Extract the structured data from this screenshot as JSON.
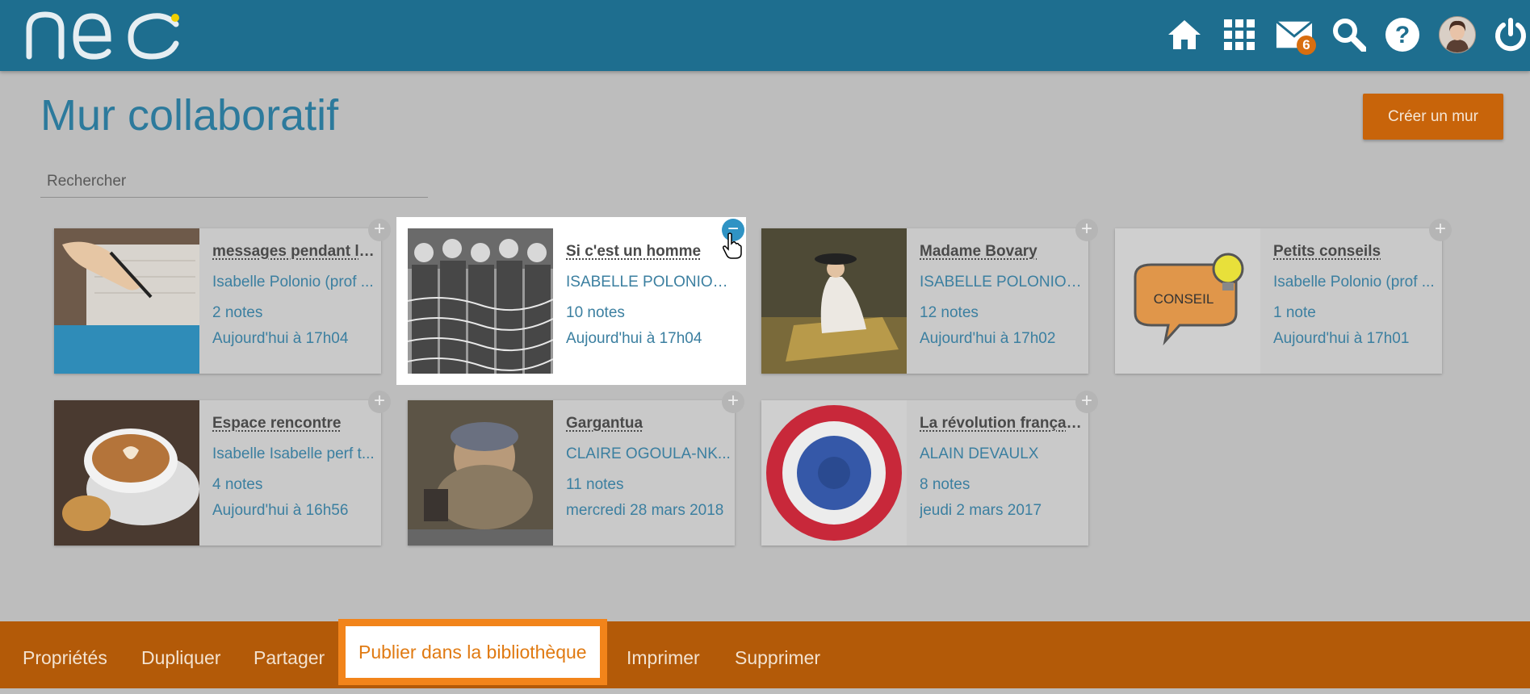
{
  "brand": {
    "logo_text": "neo",
    "logo_dot_color": "#f0d000"
  },
  "nav": {
    "icons": [
      "home-icon",
      "apps-grid-icon",
      "mail-icon",
      "search-icon",
      "help-icon",
      "avatar",
      "power-icon"
    ],
    "mail_badge": "6"
  },
  "page": {
    "title": "Mur collaboratif",
    "create_button": "Créer un mur",
    "search_placeholder": "Rechercher"
  },
  "cards": [
    {
      "title": "messages pendant le...",
      "owner": "Isabelle Polonio (prof ...",
      "notes": "2 notes",
      "date": "Aujourd'hui à 17h04",
      "selected": false,
      "thumb": "writing-hand"
    },
    {
      "title": "Si c'est un homme",
      "owner": "ISABELLE POLONIO (...",
      "notes": "10 notes",
      "date": "Aujourd'hui à 17h04",
      "selected": true,
      "thumb": "prisoners-photo"
    },
    {
      "title": "Madame Bovary",
      "owner": "ISABELLE POLONIO (...",
      "notes": "12 notes",
      "date": "Aujourd'hui à 17h02",
      "selected": false,
      "thumb": "painting-lady"
    },
    {
      "title": "Petits conseils",
      "owner": "Isabelle Polonio (prof ...",
      "notes": "1 note",
      "date": "Aujourd'hui à 17h01",
      "selected": false,
      "thumb": "conseil-bubble",
      "thumb_text": "CONSEIL"
    },
    {
      "title": "Espace rencontre",
      "owner": "Isabelle Isabelle perf t...",
      "notes": "4 notes",
      "date": "Aujourd'hui à 16h56",
      "selected": false,
      "thumb": "coffee-cup"
    },
    {
      "title": "Gargantua",
      "owner": "CLAIRE OGOULA-NK...",
      "notes": "11 notes",
      "date": "mercredi 28 mars 2018",
      "selected": false,
      "thumb": "gargantua-painting"
    },
    {
      "title": "La révolution française",
      "owner": "ALAIN DEVAULX",
      "notes": "8 notes",
      "date": "jeudi 2 mars 2017",
      "selected": false,
      "thumb": "cockade"
    }
  ],
  "actions": [
    {
      "label": "Propriétés",
      "highlight": false
    },
    {
      "label": "Dupliquer",
      "highlight": false
    },
    {
      "label": "Partager",
      "highlight": false
    },
    {
      "label": "Publier dans la bibliothèque",
      "highlight": true
    },
    {
      "label": "Imprimer",
      "highlight": false
    },
    {
      "label": "Supprimer",
      "highlight": false
    }
  ],
  "colors": {
    "topbar": "#1e6e8f",
    "accent_orange": "#c8640a",
    "title_blue": "#2c7a9c",
    "link_blue": "#3b7fa0",
    "selected_toggle": "#2f93c4"
  }
}
